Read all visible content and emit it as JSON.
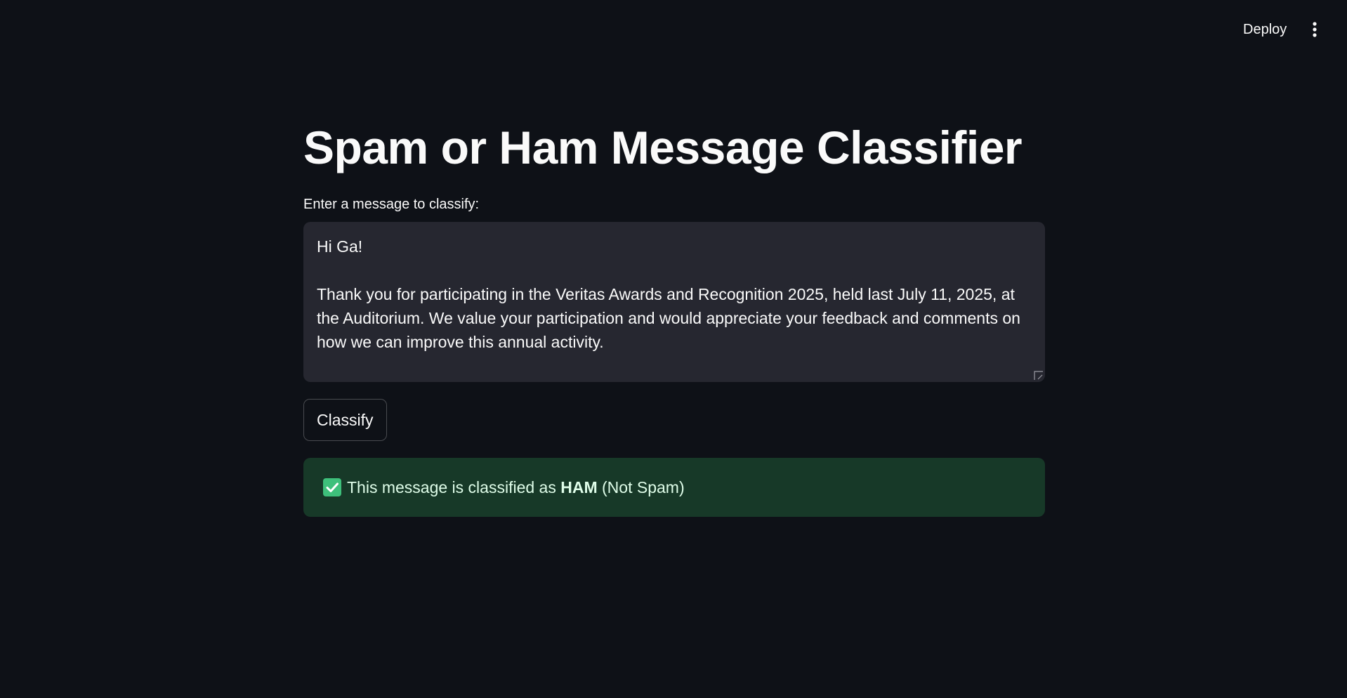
{
  "header": {
    "deploy_label": "Deploy",
    "menu_icon": "vertical-ellipsis-icon"
  },
  "main": {
    "title": "Spam or Ham Message Classifier",
    "input_label": "Enter a message to classify:",
    "message_value": "Hi Ga!\n\nThank you for participating in the Veritas Awards and Recognition 2025, held last July 11, 2025, at the Auditorium. We value your participation and would appreciate your feedback and comments on how we can improve this annual activity.",
    "classify_label": "Classify",
    "result": {
      "icon": "check-mark-button-icon",
      "prefix": "This message is classified as ",
      "label": "HAM",
      "suffix": " (Not Spam)"
    }
  },
  "colors": {
    "background": "#0e1117",
    "textarea_bg": "#262730",
    "success_bg": "#173928",
    "success_text": "#dffde9",
    "check_green": "#3ec07b"
  }
}
